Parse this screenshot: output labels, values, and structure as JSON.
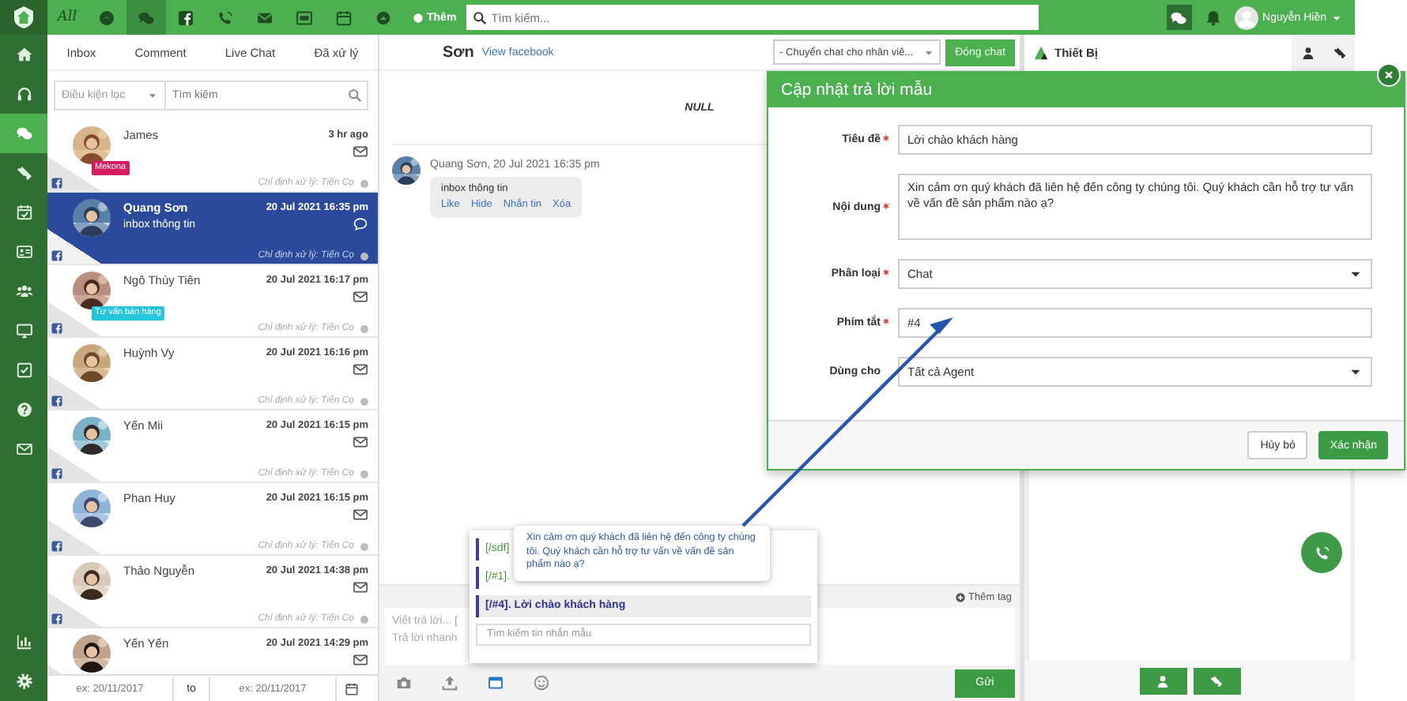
{
  "rail": {
    "items": [
      {
        "kind": "home",
        "selected": false
      },
      {
        "kind": "headset",
        "selected": false
      },
      {
        "kind": "chat",
        "selected": true
      },
      {
        "kind": "ticket",
        "selected": false
      },
      {
        "kind": "calcheck",
        "selected": false
      },
      {
        "kind": "idcard",
        "selected": false
      },
      {
        "kind": "users",
        "selected": false
      },
      {
        "kind": "monitor",
        "selected": false
      },
      {
        "kind": "check",
        "selected": false
      },
      {
        "kind": "help",
        "selected": false
      },
      {
        "kind": "mail",
        "selected": false
      }
    ],
    "bottom_items": [
      {
        "kind": "chart",
        "selected": false
      },
      {
        "kind": "gear",
        "selected": false
      }
    ]
  },
  "topbar": {
    "nav": [
      {
        "kind": "all",
        "label": "All",
        "selected": false
      },
      {
        "kind": "messenger",
        "selected": false
      },
      {
        "kind": "chat",
        "selected": true
      },
      {
        "kind": "facebook",
        "selected": false
      },
      {
        "kind": "phone",
        "selected": false
      },
      {
        "kind": "mailfill",
        "selected": false
      },
      {
        "kind": "form",
        "selected": false
      },
      {
        "kind": "calendar",
        "selected": false
      },
      {
        "kind": "up",
        "selected": false
      }
    ],
    "add_button": "Thêm",
    "search": {
      "placeholder": "Tìm kiếm..."
    },
    "user": {
      "name": "Nguyễn Hiền"
    }
  },
  "inbox": {
    "tabs": [
      "Inbox",
      "Comment",
      "Live Chat",
      "Đã xử lý"
    ],
    "filter": {
      "placeholder": "Điều kiện lọc"
    },
    "search": {
      "placeholder": "Tìm kiếm"
    },
    "conversations": [
      {
        "kind": "mail",
        "name": "James",
        "time": "3 hr ago",
        "tag": {
          "label": "Mekona",
          "color": "#d81b60"
        },
        "assignee": "Chỉ định xử lý: Tiến Cọ",
        "selected": false
      },
      {
        "kind": "chat",
        "name": "Quang Sơn",
        "time": "20 Jul 2021 16:35 pm",
        "snippet": "inbox thông tin",
        "assignee": "Chỉ định xử lý: Tiến Cọ",
        "selected": true
      },
      {
        "kind": "mail",
        "name": "Ngô Thùy Tiên",
        "time": "20 Jul 2021 16:17 pm",
        "tag": {
          "label": "Tư vấn bán hàng",
          "color": "#26c6da"
        },
        "assignee": "Chỉ định xử lý: Tiến Cọ",
        "selected": false
      },
      {
        "kind": "mail",
        "name": "Huỳnh Vy",
        "time": "20 Jul 2021 16:16 pm",
        "assignee": "Chỉ định xử lý: Tiến Cọ",
        "selected": false
      },
      {
        "kind": "mail",
        "name": "Yến Mii",
        "time": "20 Jul 2021 16:15 pm",
        "assignee": "Chỉ định xử lý: Tiến Cọ",
        "selected": false
      },
      {
        "kind": "mail",
        "name": "Phan Huy",
        "time": "20 Jul 2021 16:15 pm",
        "assignee": "Chỉ định xử lý: Tiến Cọ",
        "selected": false
      },
      {
        "kind": "mail",
        "name": "Thảo Nguyễn",
        "time": "20 Jul 2021 14:38 pm",
        "assignee": "Chỉ định xử lý: Tiến Cọ",
        "selected": false
      },
      {
        "kind": "mail",
        "name": "Yến Yến",
        "time": "20 Jul 2021 14:29 pm",
        "selected": false
      }
    ],
    "date_from": {
      "placeholder": "ex: 20/11/2017"
    },
    "date_to_label": "to",
    "date_to": {
      "placeholder": "ex: 20/11/2017"
    }
  },
  "chat": {
    "contact": "Sơn",
    "profile_link": "View facebook",
    "transfer": {
      "value": "- Chuyển chat cho nhân viê..."
    },
    "close_button": "Đóng chat",
    "header_note": "NULL",
    "messages": [
      {
        "author": "Quang Sơn, 20 Jul 2021 16:35 pm",
        "text": "inbox thông tin",
        "actions": [
          "Like",
          "Hide",
          "Nhắn tin",
          "Xóa"
        ]
      }
    ],
    "add_tag": "Thêm tag",
    "reply": {
      "placeholder": "Viết trả lời... [\nTrả lời nhanh"
    },
    "tools": [
      {
        "kind": "camera",
        "selected": false
      },
      {
        "kind": "upload",
        "selected": false
      },
      {
        "kind": "template",
        "selected": true
      },
      {
        "kind": "emoji",
        "selected": false
      }
    ],
    "send_button": "Gửi"
  },
  "templates_popup": {
    "items": [
      {
        "label": "[/sdf]",
        "selected": false
      },
      {
        "label": "[/#1].",
        "selected": false
      },
      {
        "label": "[/#4]. Lời chào khách hàng",
        "selected": true
      }
    ],
    "search": {
      "placeholder": "Tìm kiếm tin nhắn mẫu"
    },
    "preview": "Xin cảm ơn quý khách đã liên hệ đến công ty chúng tôi. Quý khách cần hỗ trợ tư vấn về vấn đề sản phẩm nào ạ?"
  },
  "side_panel": {
    "title": "Thiết Bị",
    "tabs": [
      {
        "kind": "user"
      },
      {
        "kind": "ticket"
      }
    ],
    "bottom_buttons": [
      {
        "kind": "user"
      },
      {
        "kind": "ticket"
      }
    ]
  },
  "modal": {
    "title": "Cập nhật trả lời mẫu",
    "fields": [
      {
        "label": "Tiêu đề",
        "required": true,
        "kind": "input",
        "value": "Lời chào khách hàng"
      },
      {
        "label": "Nội dung",
        "required": true,
        "kind": "textarea",
        "value": "Xin cảm ơn quý khách đã liên hệ đến công ty chúng tôi. Quý khách cần hỗ trợ tư vấn về vấn đề sản phẩm nào ạ?"
      },
      {
        "label": "Phân loại",
        "required": true,
        "kind": "select",
        "value": "Chat"
      },
      {
        "label": "Phím tắt",
        "required": true,
        "kind": "input",
        "value": "#4"
      },
      {
        "label": "Dùng cho",
        "required": false,
        "kind": "select",
        "value": "Tất cả Agent"
      }
    ],
    "buttons": [
      {
        "label": "Hủy bỏ",
        "kind": "secondary"
      },
      {
        "label": "Xác nhận",
        "kind": "primary"
      }
    ]
  }
}
